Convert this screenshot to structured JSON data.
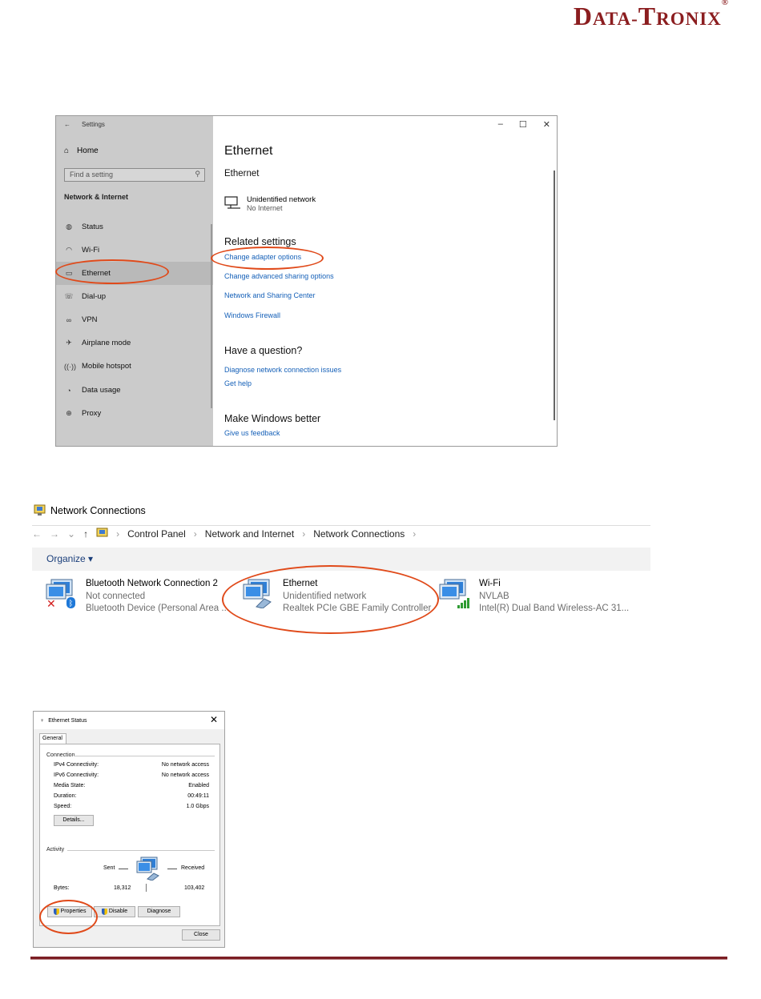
{
  "logo": {
    "brand": "DATA-TRONIX",
    "registered": "®"
  },
  "settings": {
    "title": "Settings",
    "home": "Home",
    "search_placeholder": "Find a setting",
    "section": "Network & Internet",
    "nav": [
      {
        "label": "Status",
        "icon": "status-icon"
      },
      {
        "label": "Wi-Fi",
        "icon": "wifi-icon"
      },
      {
        "label": "Ethernet",
        "icon": "ethernet-icon"
      },
      {
        "label": "Dial-up",
        "icon": "dialup-icon"
      },
      {
        "label": "VPN",
        "icon": "vpn-icon"
      },
      {
        "label": "Airplane mode",
        "icon": "airplane-icon"
      },
      {
        "label": "Mobile hotspot",
        "icon": "hotspot-icon"
      },
      {
        "label": "Data usage",
        "icon": "data-usage-icon"
      },
      {
        "label": "Proxy",
        "icon": "globe-icon"
      }
    ],
    "page_title": "Ethernet",
    "sub_title": "Ethernet",
    "network_name": "Unidentified network",
    "network_status": "No Internet",
    "related_heading": "Related settings",
    "related_links": [
      "Change adapter options",
      "Change advanced sharing options",
      "Network and Sharing Center",
      "Windows Firewall"
    ],
    "question_heading": "Have a question?",
    "question_links": [
      "Diagnose network connection issues",
      "Get help"
    ],
    "better_heading": "Make Windows better",
    "feedback_link": "Give us feedback"
  },
  "netconn": {
    "title": "Network Connections",
    "breadcrumb": [
      "Control Panel",
      "Network and Internet",
      "Network Connections"
    ],
    "organize": "Organize ▾",
    "connections": [
      {
        "name": "Bluetooth Network Connection 2",
        "status": "Not connected",
        "device": "Bluetooth Device (Personal Area ..."
      },
      {
        "name": "Ethernet",
        "status": "Unidentified network",
        "device": "Realtek PCIe GBE Family Controller"
      },
      {
        "name": "Wi-Fi",
        "status": "NVLAB",
        "device": "Intel(R) Dual Band Wireless-AC 31..."
      }
    ]
  },
  "status_dialog": {
    "title": "Ethernet Status",
    "tab": "General",
    "connection_group": "Connection",
    "rows": [
      {
        "label": "IPv4 Connectivity:",
        "value": "No network access"
      },
      {
        "label": "IPv6 Connectivity:",
        "value": "No network access"
      },
      {
        "label": "Media State:",
        "value": "Enabled"
      },
      {
        "label": "Duration:",
        "value": "00:49:11"
      },
      {
        "label": "Speed:",
        "value": "1.0 Gbps"
      }
    ],
    "details_button": "Details...",
    "activity_group": "Activity",
    "sent_label": "Sent",
    "received_label": "Received",
    "bytes_label": "Bytes:",
    "bytes_sent": "18,312",
    "bytes_received": "103,402",
    "properties_button": "Properties",
    "disable_button": "Disable",
    "diagnose_button": "Diagnose",
    "close_button": "Close"
  },
  "colors": {
    "brand": "#8b1d1f",
    "link": "#1560b8",
    "annotation": "#e04a1a",
    "rule": "#7b1e23"
  }
}
